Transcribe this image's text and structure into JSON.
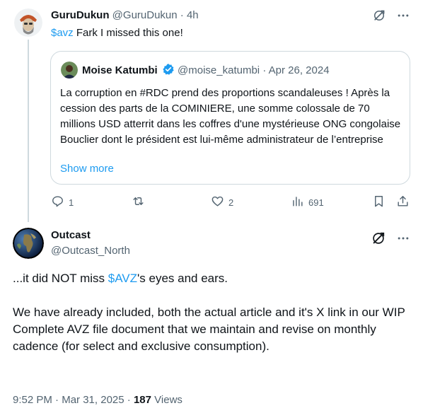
{
  "reply": {
    "author_name": "GuruDukun",
    "handle": "@GuruDukun",
    "time": "4h",
    "cashtag": "$avz",
    "text": " Fark I missed this one!",
    "quote": {
      "author_name": "Moise Katumbi",
      "handle": "@moise_katumbi",
      "date": "Apr 26, 2024",
      "text": "La corruption en #RDC prend des proportions scandaleuses ! Après la cession des parts de la COMINIERE, une somme colossale de 70 millions USD atterrit dans les coffres d'une mystérieuse ONG congolaise Bouclier dont le président est lui-même administrateur de l’entreprise",
      "show_more": "Show more"
    },
    "actions": {
      "replies": "1",
      "reposts": "",
      "likes": "2",
      "views": "691"
    }
  },
  "main": {
    "author_name": "Outcast",
    "handle": "@Outcast_North",
    "text_pre": "...it did NOT miss ",
    "cashtag": "$AVZ",
    "text_post": "'s eyes and ears.",
    "paragraph2": "We have already included, both the actual article and it's X link in our WIP Complete AVZ file document that we maintain and revise on monthly cadence (for select and exclusive consumption).",
    "time": "9:52 PM",
    "date": "Mar 31, 2025",
    "views_count": "187",
    "views_label": "Views"
  },
  "colors": {
    "accent": "#1d9bf0",
    "muted": "#536471",
    "border": "#cfd9de"
  },
  "icons": [
    "grok-icon",
    "more-icon",
    "reply-icon",
    "repost-icon",
    "like-icon",
    "views-icon",
    "bookmark-icon",
    "share-icon",
    "verified-badge-icon"
  ]
}
